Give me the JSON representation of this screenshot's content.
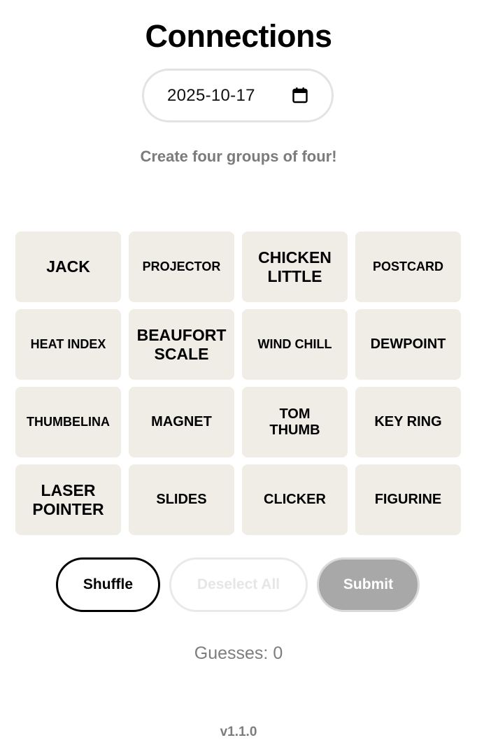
{
  "title": "Connections",
  "date": {
    "value": "2025-10-17",
    "icon": "calendar-icon"
  },
  "subtitle": "Create four groups of four!",
  "tiles": [
    {
      "label": "JACK",
      "size": "lg"
    },
    {
      "label": "PROJECTOR",
      "size": "sm"
    },
    {
      "label": "CHICKEN\nLITTLE",
      "size": "lg"
    },
    {
      "label": "POSTCARD",
      "size": "sm"
    },
    {
      "label": "HEAT INDEX",
      "size": "sm"
    },
    {
      "label": "BEAUFORT\nSCALE",
      "size": "lg"
    },
    {
      "label": "WIND CHILL",
      "size": "sm"
    },
    {
      "label": "DEWPOINT",
      "size": "md"
    },
    {
      "label": "THUMBELINA",
      "size": "sm"
    },
    {
      "label": "MAGNET",
      "size": "md"
    },
    {
      "label": "TOM\nTHUMB",
      "size": "md"
    },
    {
      "label": "KEY RING",
      "size": "md"
    },
    {
      "label": "LASER\nPOINTER",
      "size": "lg"
    },
    {
      "label": "SLIDES",
      "size": "md"
    },
    {
      "label": "CLICKER",
      "size": "md"
    },
    {
      "label": "FIGURINE",
      "size": "md"
    }
  ],
  "buttons": {
    "shuffle": "Shuffle",
    "deselect_all": "Deselect All",
    "submit": "Submit"
  },
  "guesses": "Guesses: 0",
  "version": "v1.1.0",
  "colors": {
    "tile_bg": "#efede6",
    "submit_disabled": "#a8a8a8",
    "muted_text": "#7b7b7b"
  }
}
